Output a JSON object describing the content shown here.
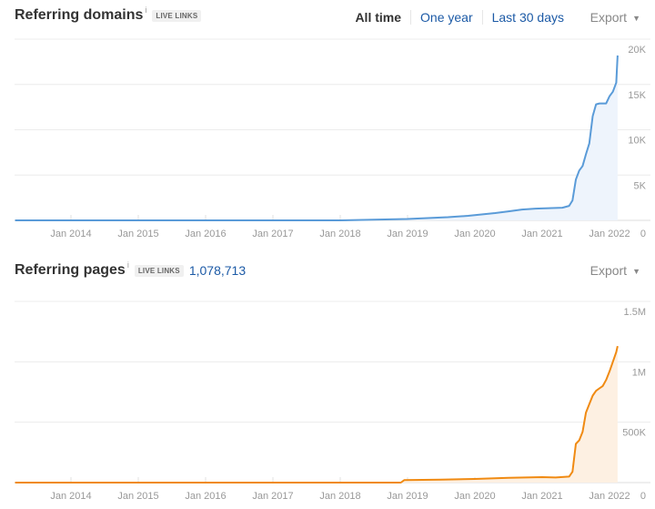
{
  "time_filters": {
    "all_time": "All time",
    "one_year": "One year",
    "last_30_days": "Last 30 days",
    "active": "All time"
  },
  "referring_domains": {
    "title": "Referring domains",
    "info_icon": "i",
    "badge": "LIVE LINKS",
    "export_label": "Export",
    "export_icon": "▼"
  },
  "referring_pages": {
    "title": "Referring pages",
    "info_icon": "i",
    "badge": "LIVE LINKS",
    "total": "1,078,713",
    "export_label": "Export",
    "export_icon": "▼"
  },
  "chart_data": [
    {
      "type": "area",
      "title": "Referring domains",
      "color": "#5a9bd8",
      "fill": "#eef4fc",
      "x_ticks": [
        "Jan 2014",
        "Jan 2015",
        "Jan 2016",
        "Jan 2017",
        "Jan 2018",
        "Jan 2019",
        "Jan 2020",
        "Jan 2021",
        "Jan 2022"
      ],
      "y_ticks": [
        "0",
        "5K",
        "10K",
        "15K",
        "20K"
      ],
      "y_tick_values": [
        0,
        5000,
        10000,
        15000,
        20000
      ],
      "xlim": [
        2013.17,
        2022.17
      ],
      "ylim": [
        0,
        20000
      ],
      "x": [
        2013.17,
        2018.0,
        2018.5,
        2019.0,
        2019.3,
        2019.6,
        2019.9,
        2020.1,
        2020.3,
        2020.5,
        2020.7,
        2020.9,
        2021.1,
        2021.3,
        2021.4,
        2021.45,
        2021.5,
        2021.55,
        2021.6,
        2021.65,
        2021.7,
        2021.75,
        2021.8,
        2021.85,
        2021.9,
        2021.95,
        2022.0,
        2022.05,
        2022.1,
        2022.12
      ],
      "y": [
        0,
        0,
        80,
        150,
        250,
        350,
        500,
        650,
        800,
        1000,
        1200,
        1300,
        1350,
        1400,
        1600,
        2200,
        4500,
        5500,
        6000,
        7300,
        8500,
        11500,
        12800,
        12900,
        12900,
        12900,
        13700,
        14200,
        15200,
        18200
      ],
      "grid": true
    },
    {
      "type": "area",
      "title": "Referring pages",
      "color": "#f08a12",
      "fill": "#fdf0e2",
      "x_ticks": [
        "Jan 2014",
        "Jan 2015",
        "Jan 2016",
        "Jan 2017",
        "Jan 2018",
        "Jan 2019",
        "Jan 2020",
        "Jan 2021",
        "Jan 2022"
      ],
      "y_ticks": [
        "0",
        "500K",
        "1M",
        "1.5M"
      ],
      "y_tick_values": [
        0,
        500000,
        1000000,
        1500000
      ],
      "xlim": [
        2013.17,
        2022.17
      ],
      "ylim": [
        0,
        1500000
      ],
      "x": [
        2013.17,
        2018.9,
        2018.95,
        2019.5,
        2020.0,
        2020.5,
        2021.0,
        2021.2,
        2021.4,
        2021.45,
        2021.5,
        2021.55,
        2021.6,
        2021.65,
        2021.7,
        2021.75,
        2021.8,
        2021.85,
        2021.9,
        2021.95,
        2022.0,
        2022.05,
        2022.1,
        2022.12
      ],
      "y": [
        0,
        0,
        20000,
        25000,
        30000,
        40000,
        45000,
        42000,
        50000,
        90000,
        320000,
        350000,
        420000,
        580000,
        650000,
        720000,
        760000,
        780000,
        800000,
        850000,
        920000,
        1000000,
        1080000,
        1130000
      ],
      "grid": true
    }
  ]
}
